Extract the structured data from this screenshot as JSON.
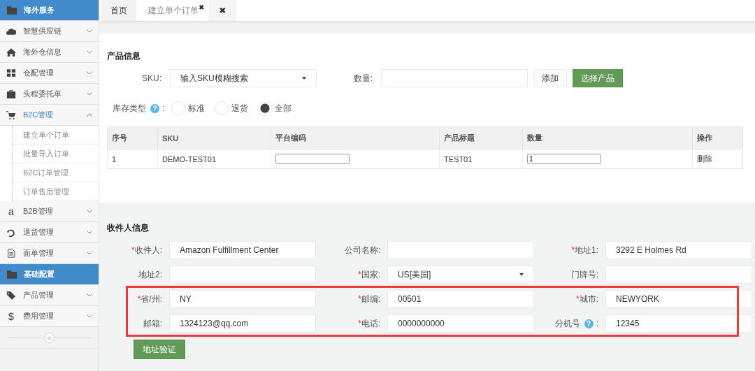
{
  "sidebar": {
    "items": [
      {
        "kind": "header",
        "label": "海外服务"
      },
      {
        "kind": "menu",
        "label": "智慧供应链",
        "expanded": false
      },
      {
        "kind": "menu",
        "label": "海外仓信息",
        "expanded": false
      },
      {
        "kind": "menu",
        "label": "仓配管理",
        "expanded": false
      },
      {
        "kind": "menu",
        "label": "头程委托单",
        "expanded": false
      },
      {
        "kind": "menu",
        "label": "B2C管理",
        "expanded": true,
        "children": [
          {
            "label": "建立单个订单",
            "selected": false
          },
          {
            "label": "批量导入订单",
            "selected": false
          },
          {
            "label": "B2C订单管理",
            "selected": false
          },
          {
            "label": "订单售后管理",
            "selected": false
          }
        ]
      },
      {
        "kind": "menu",
        "label": "B2B管理",
        "expanded": false,
        "glyph": "a"
      },
      {
        "kind": "menu",
        "label": "退货管理",
        "expanded": false
      },
      {
        "kind": "menu",
        "label": "面单管理",
        "expanded": false
      },
      {
        "kind": "header",
        "label": "基础配置"
      },
      {
        "kind": "menu",
        "label": "产品管理",
        "expanded": false
      },
      {
        "kind": "menu",
        "label": "费用管理",
        "expanded": false,
        "glyph": "$"
      }
    ],
    "collapse_button": "«"
  },
  "tabs": [
    {
      "label": "首页",
      "selected": false
    },
    {
      "label": "建立单个订单",
      "selected": true,
      "close": "✖"
    }
  ],
  "close_all_tab": "✖",
  "product": {
    "title": "产品信息",
    "sku": {
      "label": "SKU:",
      "placeholder": "输入SKU模糊搜索"
    },
    "quantity": {
      "label": "数量:"
    },
    "buttons": [
      {
        "kind": "plain",
        "label": "添加"
      },
      {
        "kind": "primary",
        "label": "选择产品"
      }
    ],
    "stock_type": {
      "label": "库存类型",
      "help": "?",
      "colon": ":",
      "options": [
        {
          "label": "标准",
          "selected": false
        },
        {
          "label": "退货",
          "selected": false
        },
        {
          "label": "全部",
          "selected": true
        }
      ]
    },
    "table": {
      "columns": [
        "序号",
        "SKU",
        "平台编码",
        "产品标题",
        "数量",
        "操作"
      ],
      "rows": [
        [
          {
            "kind": "text",
            "text": "1"
          },
          {
            "kind": "text",
            "text": "DEMO-TEST01"
          },
          {
            "kind": "input"
          },
          {
            "kind": "text",
            "text": "TEST01"
          },
          {
            "kind": "input",
            "value": "1"
          },
          {
            "kind": "link",
            "text": "删除"
          }
        ]
      ]
    }
  },
  "recipient": {
    "title": "收件人信息",
    "rows": [
      {
        "highlighted": false,
        "fields": [
          {
            "label": "收件人:",
            "required_mark": "*",
            "kind": "input",
            "value": "Amazon Fulfillment Center"
          },
          {
            "label": "公司名称:",
            "kind": "input"
          },
          {
            "label": "地址1:",
            "required_mark": "*",
            "kind": "input",
            "value": "3292 E Holmes Rd"
          }
        ]
      },
      {
        "highlighted": false,
        "fields": [
          {
            "label": "地址2:",
            "kind": "input"
          },
          {
            "label": "国家:",
            "required_mark": "*",
            "kind": "select",
            "value": "US[美国]"
          },
          {
            "label": "门牌号:",
            "kind": "input"
          }
        ]
      },
      {
        "highlighted": true,
        "fields": [
          {
            "label": "省/州:",
            "required_mark": "*",
            "kind": "input",
            "value": "NY"
          },
          {
            "label": "邮编:",
            "required_mark": "*",
            "kind": "input",
            "value": "00501"
          },
          {
            "label": "城市:",
            "required_mark": "*",
            "kind": "input",
            "value": "NEWYORK"
          }
        ]
      },
      {
        "highlighted": true,
        "fields": [
          {
            "label": "邮箱:",
            "kind": "input",
            "value": "1324123@qq.com"
          },
          {
            "label": "电话:",
            "required_mark": "*",
            "kind": "input",
            "value": "0000000000"
          },
          {
            "label": "分机号",
            "help": "?",
            "colon": ":",
            "kind": "input",
            "value": "12345"
          }
        ]
      }
    ],
    "verify_button": "地址验证"
  }
}
